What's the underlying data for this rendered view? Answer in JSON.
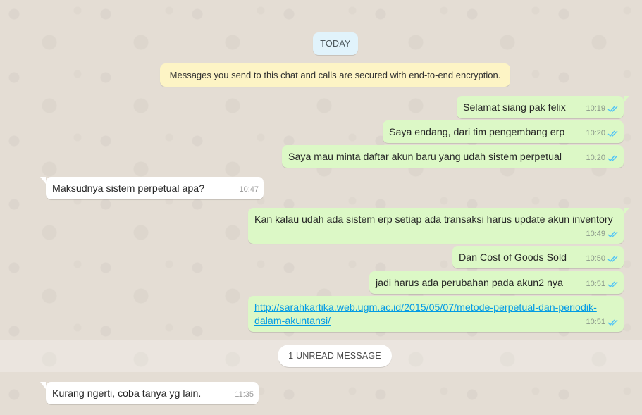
{
  "chat": {
    "day_label": "TODAY",
    "encryption_notice": "Messages you send to this chat and calls are secured with end-to-end encryption.",
    "unread_label": "1 UNREAD MESSAGE",
    "colors": {
      "outgoing_bubble": "#dcf8c6",
      "incoming_bubble": "#ffffff",
      "read_ticks": "#4fc3f7",
      "link": "#039be5"
    },
    "messages": [
      {
        "direction": "out",
        "text": "Selamat siang pak felix",
        "time": "10:19",
        "status": "read"
      },
      {
        "direction": "out",
        "text": "Saya endang, dari tim pengembang erp",
        "time": "10:20",
        "status": "read"
      },
      {
        "direction": "out",
        "text": "Saya mau minta daftar akun baru yang udah sistem perpetual",
        "time": "10:20",
        "status": "read"
      },
      {
        "direction": "in",
        "text": "Maksudnya sistem perpetual apa?",
        "time": "10:47"
      },
      {
        "direction": "out",
        "text": "Kan kalau udah ada sistem erp setiap ada transaksi harus update akun inventory",
        "time": "10:49",
        "status": "read"
      },
      {
        "direction": "out",
        "text": "Dan Cost of Goods Sold",
        "time": "10:50",
        "status": "read"
      },
      {
        "direction": "out",
        "text": "jadi harus ada perubahan pada akun2 nya",
        "time": "10:51",
        "status": "read"
      },
      {
        "direction": "out",
        "text": "http://sarahkartika.web.ugm.ac.id/2015/05/07/metode-perpetual-dan-periodik-dalam-akuntansi/",
        "time": "10:51",
        "status": "read",
        "is_link": true
      },
      {
        "direction": "in",
        "text": "Kurang ngerti, coba tanya yg lain.",
        "time": "11:35"
      }
    ]
  }
}
